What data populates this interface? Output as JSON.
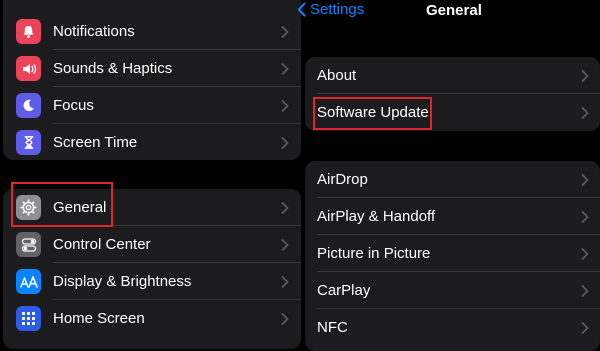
{
  "left_settings": {
    "group1": [
      {
        "label": "Notifications",
        "icon": "bell-icon",
        "color": "#eb445a"
      },
      {
        "label": "Sounds & Haptics",
        "icon": "speaker-icon",
        "color": "#eb445a"
      },
      {
        "label": "Focus",
        "icon": "moon-icon",
        "color": "#5e5ce6"
      },
      {
        "label": "Screen Time",
        "icon": "hourglass-icon",
        "color": "#5e5ce6"
      }
    ],
    "group2": [
      {
        "label": "General",
        "icon": "gear-icon",
        "color": "#8e8e93"
      },
      {
        "label": "Control Center",
        "icon": "toggles-icon",
        "color": "#636366"
      },
      {
        "label": "Display & Brightness",
        "icon": "text-size-icon",
        "color": "#0a84ff"
      },
      {
        "label": "Home Screen",
        "icon": "app-grid-icon",
        "color": "#2c5ce6"
      }
    ]
  },
  "general_pane": {
    "back_label": "Settings",
    "title": "General",
    "group1": [
      {
        "label": "About"
      },
      {
        "label": "Software Update"
      }
    ],
    "group2": [
      {
        "label": "AirDrop"
      },
      {
        "label": "AirPlay & Handoff"
      },
      {
        "label": "Picture in Picture"
      },
      {
        "label": "CarPlay"
      },
      {
        "label": "NFC"
      }
    ]
  },
  "colors": {
    "accent": "#0a84ff",
    "highlight_box": "#e0262a",
    "cell_background": "#1c1c1e",
    "separator": "#38383a"
  }
}
